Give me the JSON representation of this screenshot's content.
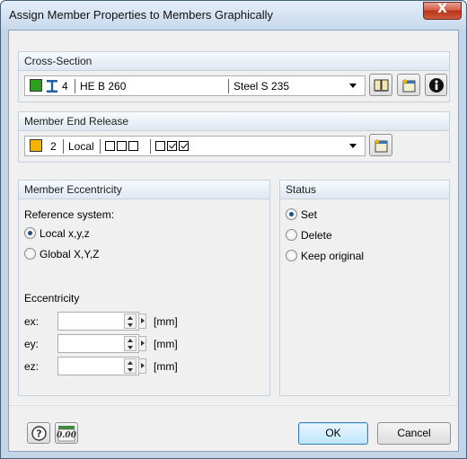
{
  "window": {
    "title": "Assign Member Properties to Members Graphically",
    "close_glyph": "X"
  },
  "cross_section": {
    "heading": "Cross-Section",
    "number": "4",
    "name": "HE B 260",
    "material": "Steel S 235",
    "swatch_color": "#2e9e1f",
    "icons": [
      "library-icon",
      "new-cross-section-icon",
      "info-icon"
    ]
  },
  "member_end_release": {
    "heading": "Member End Release",
    "number": "2",
    "system": "Local",
    "start_checks": [
      false,
      false,
      false
    ],
    "end_checks": [
      false,
      true,
      true
    ],
    "swatch_color": "#f2b400"
  },
  "eccentricity": {
    "heading": "Member Eccentricity",
    "reference_label": "Reference system:",
    "options": [
      {
        "label": "Local x,y,z",
        "selected": true
      },
      {
        "label": "Global X,Y,Z",
        "selected": false
      }
    ],
    "eccentricity_label": "Eccentricity",
    "fields": [
      {
        "label": "ex:",
        "value": "",
        "unit": "[mm]"
      },
      {
        "label": "ey:",
        "value": "",
        "unit": "[mm]"
      },
      {
        "label": "ez:",
        "value": "",
        "unit": "[mm]"
      }
    ]
  },
  "status": {
    "heading": "Status",
    "options": [
      {
        "label": "Set",
        "selected": true
      },
      {
        "label": "Delete",
        "selected": false
      },
      {
        "label": "Keep original",
        "selected": false
      }
    ]
  },
  "footer": {
    "units_icon_text": "0.00",
    "ok_label": "OK",
    "cancel_label": "Cancel"
  }
}
